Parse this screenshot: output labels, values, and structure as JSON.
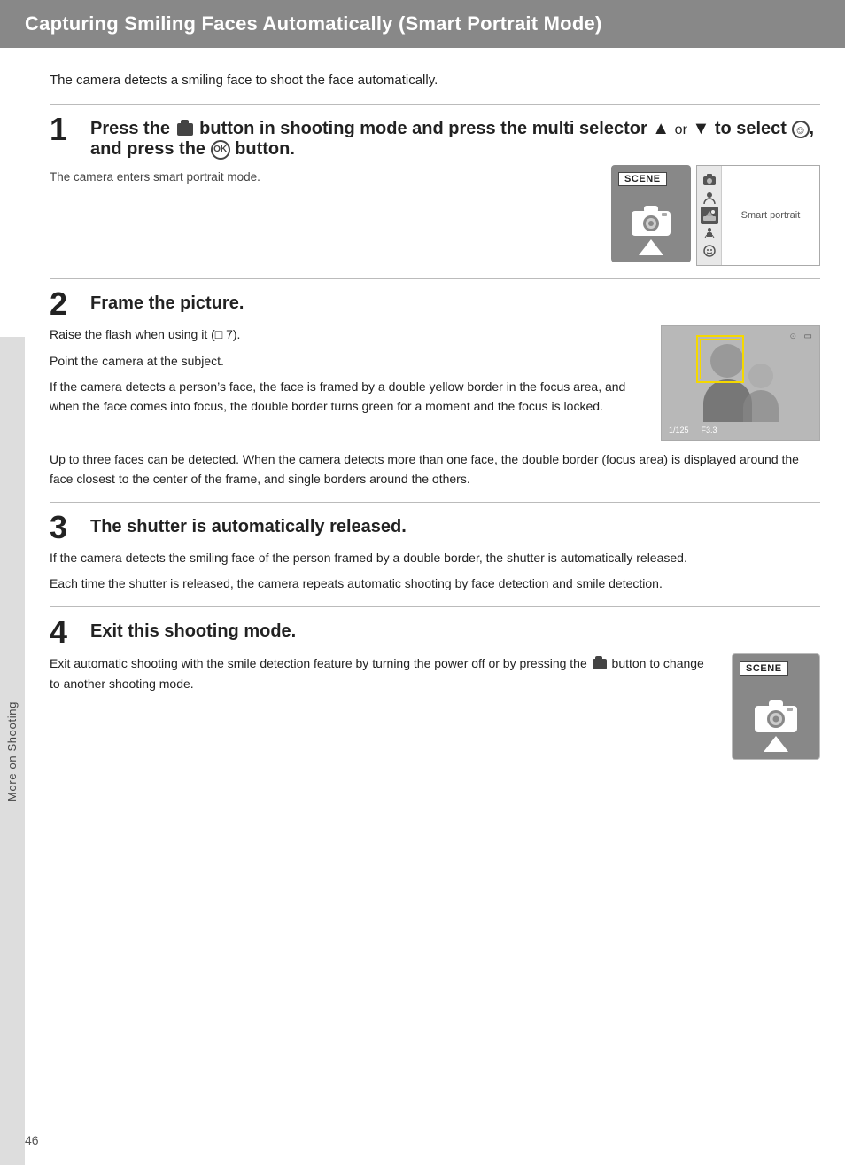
{
  "header": {
    "title": "Capturing Smiling Faces Automatically (Smart Portrait Mode)"
  },
  "sidebar": {
    "label": "More on Shooting"
  },
  "intro": {
    "text": "The camera detects a smiling face to shoot the face automatically."
  },
  "steps": [
    {
      "number": "1",
      "title": "Press the",
      "title_full": "Press the 📷 button in shooting mode and press the multi selector ▲ or ▼ to select ☺, and press the ⊙ button.",
      "sub_note": "The camera enters smart portrait mode.",
      "image_label": "SCENE",
      "menu_label": "Smart portrait"
    },
    {
      "number": "2",
      "title": "Frame the picture.",
      "para1": "Raise the flash when using it (□ 7).",
      "para2": "Point the camera at the subject.",
      "para3": "If the camera detects a person’s face, the face is framed by a double yellow border in the focus area, and when the face comes into focus, the double border turns green for a moment and the focus is locked.",
      "para4": "Up to three faces can be detected. When the camera detects more than one face, the double border (focus area) is displayed around the face closest to the center of the frame, and single borders around the others.",
      "vf_status1": "1/125",
      "vf_status2": "F3.3"
    },
    {
      "number": "3",
      "title": "The shutter is automatically released.",
      "para1": "If the camera detects the smiling face of the person framed by a double border, the shutter is automatically released.",
      "para2": "Each time the shutter is released, the camera repeats automatic shooting by face detection and smile detection."
    },
    {
      "number": "4",
      "title": "Exit this shooting mode.",
      "para1": "Exit automatic shooting with the smile detection feature by turning the power off or by pressing the 📷 button to change to another shooting mode.",
      "image_label": "SCENE"
    }
  ],
  "page_number": "46",
  "or_text": "or"
}
